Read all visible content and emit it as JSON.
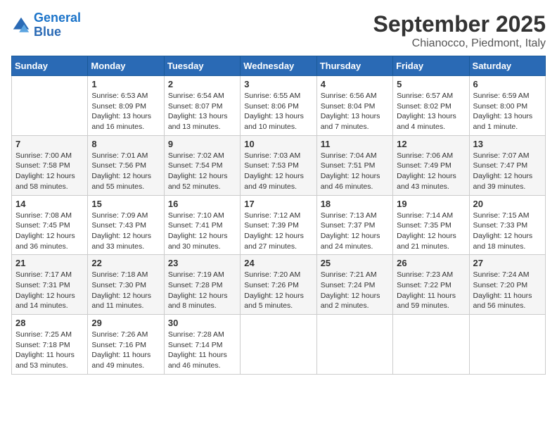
{
  "header": {
    "logo_line1": "General",
    "logo_line2": "Blue",
    "month": "September 2025",
    "location": "Chianocco, Piedmont, Italy"
  },
  "days_of_week": [
    "Sunday",
    "Monday",
    "Tuesday",
    "Wednesday",
    "Thursday",
    "Friday",
    "Saturday"
  ],
  "weeks": [
    [
      {
        "day": "",
        "sunrise": "",
        "sunset": "",
        "daylight": ""
      },
      {
        "day": "1",
        "sunrise": "Sunrise: 6:53 AM",
        "sunset": "Sunset: 8:09 PM",
        "daylight": "Daylight: 13 hours and 16 minutes."
      },
      {
        "day": "2",
        "sunrise": "Sunrise: 6:54 AM",
        "sunset": "Sunset: 8:07 PM",
        "daylight": "Daylight: 13 hours and 13 minutes."
      },
      {
        "day": "3",
        "sunrise": "Sunrise: 6:55 AM",
        "sunset": "Sunset: 8:06 PM",
        "daylight": "Daylight: 13 hours and 10 minutes."
      },
      {
        "day": "4",
        "sunrise": "Sunrise: 6:56 AM",
        "sunset": "Sunset: 8:04 PM",
        "daylight": "Daylight: 13 hours and 7 minutes."
      },
      {
        "day": "5",
        "sunrise": "Sunrise: 6:57 AM",
        "sunset": "Sunset: 8:02 PM",
        "daylight": "Daylight: 13 hours and 4 minutes."
      },
      {
        "day": "6",
        "sunrise": "Sunrise: 6:59 AM",
        "sunset": "Sunset: 8:00 PM",
        "daylight": "Daylight: 13 hours and 1 minute."
      }
    ],
    [
      {
        "day": "7",
        "sunrise": "Sunrise: 7:00 AM",
        "sunset": "Sunset: 7:58 PM",
        "daylight": "Daylight: 12 hours and 58 minutes."
      },
      {
        "day": "8",
        "sunrise": "Sunrise: 7:01 AM",
        "sunset": "Sunset: 7:56 PM",
        "daylight": "Daylight: 12 hours and 55 minutes."
      },
      {
        "day": "9",
        "sunrise": "Sunrise: 7:02 AM",
        "sunset": "Sunset: 7:54 PM",
        "daylight": "Daylight: 12 hours and 52 minutes."
      },
      {
        "day": "10",
        "sunrise": "Sunrise: 7:03 AM",
        "sunset": "Sunset: 7:53 PM",
        "daylight": "Daylight: 12 hours and 49 minutes."
      },
      {
        "day": "11",
        "sunrise": "Sunrise: 7:04 AM",
        "sunset": "Sunset: 7:51 PM",
        "daylight": "Daylight: 12 hours and 46 minutes."
      },
      {
        "day": "12",
        "sunrise": "Sunrise: 7:06 AM",
        "sunset": "Sunset: 7:49 PM",
        "daylight": "Daylight: 12 hours and 43 minutes."
      },
      {
        "day": "13",
        "sunrise": "Sunrise: 7:07 AM",
        "sunset": "Sunset: 7:47 PM",
        "daylight": "Daylight: 12 hours and 39 minutes."
      }
    ],
    [
      {
        "day": "14",
        "sunrise": "Sunrise: 7:08 AM",
        "sunset": "Sunset: 7:45 PM",
        "daylight": "Daylight: 12 hours and 36 minutes."
      },
      {
        "day": "15",
        "sunrise": "Sunrise: 7:09 AM",
        "sunset": "Sunset: 7:43 PM",
        "daylight": "Daylight: 12 hours and 33 minutes."
      },
      {
        "day": "16",
        "sunrise": "Sunrise: 7:10 AM",
        "sunset": "Sunset: 7:41 PM",
        "daylight": "Daylight: 12 hours and 30 minutes."
      },
      {
        "day": "17",
        "sunrise": "Sunrise: 7:12 AM",
        "sunset": "Sunset: 7:39 PM",
        "daylight": "Daylight: 12 hours and 27 minutes."
      },
      {
        "day": "18",
        "sunrise": "Sunrise: 7:13 AM",
        "sunset": "Sunset: 7:37 PM",
        "daylight": "Daylight: 12 hours and 24 minutes."
      },
      {
        "day": "19",
        "sunrise": "Sunrise: 7:14 AM",
        "sunset": "Sunset: 7:35 PM",
        "daylight": "Daylight: 12 hours and 21 minutes."
      },
      {
        "day": "20",
        "sunrise": "Sunrise: 7:15 AM",
        "sunset": "Sunset: 7:33 PM",
        "daylight": "Daylight: 12 hours and 18 minutes."
      }
    ],
    [
      {
        "day": "21",
        "sunrise": "Sunrise: 7:17 AM",
        "sunset": "Sunset: 7:31 PM",
        "daylight": "Daylight: 12 hours and 14 minutes."
      },
      {
        "day": "22",
        "sunrise": "Sunrise: 7:18 AM",
        "sunset": "Sunset: 7:30 PM",
        "daylight": "Daylight: 12 hours and 11 minutes."
      },
      {
        "day": "23",
        "sunrise": "Sunrise: 7:19 AM",
        "sunset": "Sunset: 7:28 PM",
        "daylight": "Daylight: 12 hours and 8 minutes."
      },
      {
        "day": "24",
        "sunrise": "Sunrise: 7:20 AM",
        "sunset": "Sunset: 7:26 PM",
        "daylight": "Daylight: 12 hours and 5 minutes."
      },
      {
        "day": "25",
        "sunrise": "Sunrise: 7:21 AM",
        "sunset": "Sunset: 7:24 PM",
        "daylight": "Daylight: 12 hours and 2 minutes."
      },
      {
        "day": "26",
        "sunrise": "Sunrise: 7:23 AM",
        "sunset": "Sunset: 7:22 PM",
        "daylight": "Daylight: 11 hours and 59 minutes."
      },
      {
        "day": "27",
        "sunrise": "Sunrise: 7:24 AM",
        "sunset": "Sunset: 7:20 PM",
        "daylight": "Daylight: 11 hours and 56 minutes."
      }
    ],
    [
      {
        "day": "28",
        "sunrise": "Sunrise: 7:25 AM",
        "sunset": "Sunset: 7:18 PM",
        "daylight": "Daylight: 11 hours and 53 minutes."
      },
      {
        "day": "29",
        "sunrise": "Sunrise: 7:26 AM",
        "sunset": "Sunset: 7:16 PM",
        "daylight": "Daylight: 11 hours and 49 minutes."
      },
      {
        "day": "30",
        "sunrise": "Sunrise: 7:28 AM",
        "sunset": "Sunset: 7:14 PM",
        "daylight": "Daylight: 11 hours and 46 minutes."
      },
      {
        "day": "",
        "sunrise": "",
        "sunset": "",
        "daylight": ""
      },
      {
        "day": "",
        "sunrise": "",
        "sunset": "",
        "daylight": ""
      },
      {
        "day": "",
        "sunrise": "",
        "sunset": "",
        "daylight": ""
      },
      {
        "day": "",
        "sunrise": "",
        "sunset": "",
        "daylight": ""
      }
    ]
  ]
}
